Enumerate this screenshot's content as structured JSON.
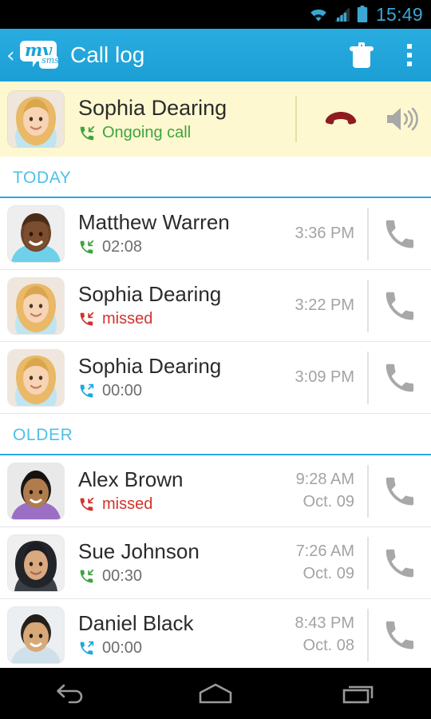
{
  "status_bar": {
    "time": "15:49",
    "icons": [
      "wifi-icon",
      "signal-icon",
      "battery-icon"
    ],
    "tint_color": "#3aa7d4"
  },
  "app_bar": {
    "back_label": "‹",
    "logo_text": "my",
    "logo_sub_text": "sms",
    "title": "Call log",
    "actions": [
      {
        "name": "delete-button",
        "icon": "trash-icon"
      },
      {
        "name": "overflow-menu-button",
        "icon": "more-vertical-icon"
      }
    ],
    "background_color": "#1b9fd4"
  },
  "ongoing_call": {
    "name": "Sophia Dearing",
    "status": "Ongoing call",
    "status_color": "#3fa33f",
    "direction_icon": "call-incoming-icon",
    "background_color": "#fdf8cf",
    "hangup_label": "hang-up-button",
    "speaker_label": "speaker-button",
    "hangup_color": "#8e1c22",
    "speaker_color": "#a8a8a8"
  },
  "colors": {
    "accent": "#2aaae0",
    "incoming": "#3fa33f",
    "outgoing": "#1ea7e0",
    "missed": "#d0342c",
    "call_button": "#a8a8a8"
  },
  "sections": [
    {
      "header": "TODAY",
      "rows": [
        {
          "name": "Matthew Warren",
          "duration": "02:08",
          "direction": "incoming",
          "direction_icon": "call-incoming-icon",
          "time": "3:36 PM",
          "date": "",
          "avatar": "male-1",
          "call_button": "call-button"
        },
        {
          "name": "Sophia Dearing",
          "duration": "missed",
          "direction": "missed",
          "direction_icon": "call-missed-icon",
          "time": "3:22 PM",
          "date": "",
          "avatar": "female-1",
          "call_button": "call-button"
        },
        {
          "name": "Sophia Dearing",
          "duration": "00:00",
          "direction": "outgoing",
          "direction_icon": "call-outgoing-icon",
          "time": "3:09 PM",
          "date": "",
          "avatar": "female-1",
          "call_button": "call-button"
        }
      ]
    },
    {
      "header": "OLDER",
      "rows": [
        {
          "name": "Alex Brown",
          "duration": "missed",
          "direction": "missed",
          "direction_icon": "call-missed-icon",
          "time": "9:28 AM",
          "date": "Oct. 09",
          "avatar": "male-2",
          "call_button": "call-button"
        },
        {
          "name": "Sue Johnson",
          "duration": "00:30",
          "direction": "incoming",
          "direction_icon": "call-incoming-icon",
          "time": "7:26 AM",
          "date": "Oct. 09",
          "avatar": "female-2",
          "call_button": "call-button"
        },
        {
          "name": "Daniel Black",
          "duration": "00:00",
          "direction": "outgoing",
          "direction_icon": "call-outgoing-icon",
          "time": "8:43 PM",
          "date": "Oct. 08",
          "avatar": "male-3",
          "call_button": "call-button"
        }
      ]
    }
  ],
  "nav_bar": {
    "buttons": [
      {
        "name": "nav-back-button",
        "icon": "back-arrow-icon"
      },
      {
        "name": "nav-home-button",
        "icon": "home-icon"
      },
      {
        "name": "nav-recents-button",
        "icon": "recents-icon"
      }
    ]
  }
}
